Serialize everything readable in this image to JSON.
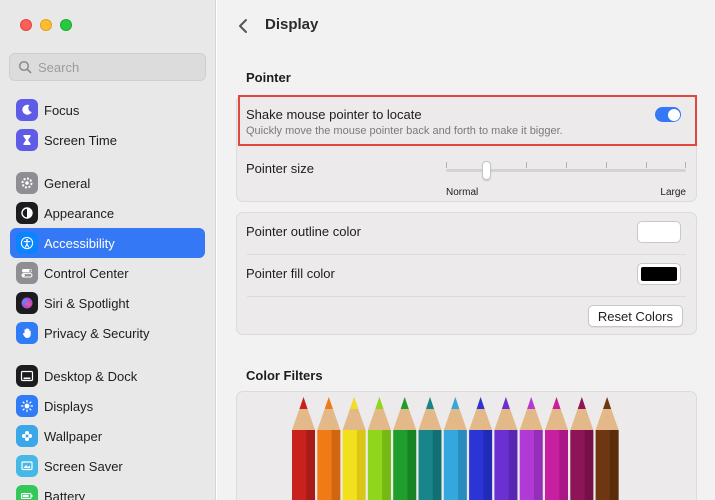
{
  "window": {
    "controls": [
      "close",
      "minimize",
      "zoom"
    ]
  },
  "search": {
    "placeholder": "Search"
  },
  "sidebar": {
    "items": [
      {
        "label": "Focus",
        "icon": "moon-icon",
        "color": "#5e5ce6"
      },
      {
        "label": "Screen Time",
        "icon": "hourglass-icon",
        "color": "#5e5ce6"
      },
      {
        "label": "General",
        "icon": "gear-icon",
        "color": "#8e8e93"
      },
      {
        "label": "Appearance",
        "icon": "appearance-icon",
        "color": "#1c1c1e"
      },
      {
        "label": "Accessibility",
        "icon": "accessibility-icon",
        "color": "#0a84ff",
        "active": true
      },
      {
        "label": "Control Center",
        "icon": "toggles-icon",
        "color": "#8e8e93"
      },
      {
        "label": "Siri & Spotlight",
        "icon": "siri-icon",
        "color": "#b04bd9"
      },
      {
        "label": "Privacy & Security",
        "icon": "hand-icon",
        "color": "#2f7cf6"
      },
      {
        "label": "Desktop & Dock",
        "icon": "dock-icon",
        "color": "#1c1c1e"
      },
      {
        "label": "Displays",
        "icon": "sun-icon",
        "color": "#2f7cf6"
      },
      {
        "label": "Wallpaper",
        "icon": "flower-icon",
        "color": "#3aa7e8"
      },
      {
        "label": "Screen Saver",
        "icon": "screensaver-icon",
        "color": "#45b8e6"
      },
      {
        "label": "Battery",
        "icon": "battery-icon",
        "color": "#34c759"
      }
    ]
  },
  "header": {
    "title": "Display"
  },
  "pointer": {
    "section_title": "Pointer",
    "shake": {
      "label": "Shake mouse pointer to locate",
      "description": "Quickly move the mouse pointer back and forth to make it bigger.",
      "enabled": true
    },
    "size": {
      "label": "Pointer size",
      "min_label": "Normal",
      "max_label": "Large",
      "value_fraction": 0.17
    },
    "outline_color": {
      "label": "Pointer outline color",
      "value": "#ffffff"
    },
    "fill_color": {
      "label": "Pointer fill color",
      "value": "#000000"
    },
    "reset_label": "Reset Colors"
  },
  "color_filters": {
    "section_title": "Color Filters"
  },
  "colors": {
    "accent": "#3478f6",
    "highlight": "#e0473f"
  }
}
